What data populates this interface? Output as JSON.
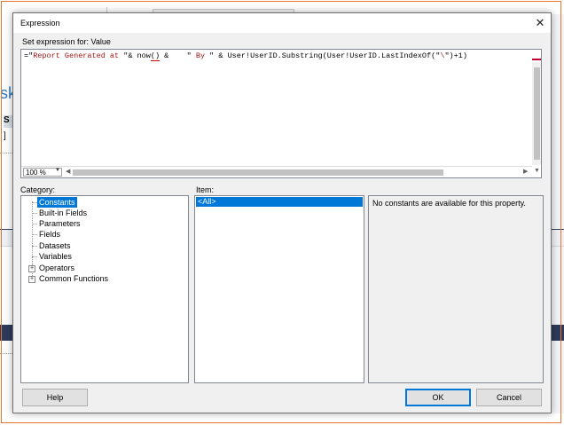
{
  "background": {
    "fragment_k": "sk",
    "fragment_s": "S",
    "fragment_bracket": "]"
  },
  "dialog": {
    "title": "Expression",
    "close_glyph": "✕",
    "set_expression_label": "Set expression for: Value",
    "expression": {
      "part1": "=\"",
      "str1": "Report Generated at ",
      "part2": "\"& now",
      "caret_text": "()",
      "part3": " &    \"",
      "str2": " By ",
      "part4": "\" & User!UserID.Substring(User!UserID.LastIndexOf(\"",
      "str3": "\\",
      "part5": "\")+1)"
    },
    "zoom": "100 %",
    "category_label": "Category:",
    "item_label": "Item:",
    "categories": [
      {
        "label": "Constants",
        "selected": true,
        "expandable": false
      },
      {
        "label": "Built-in Fields",
        "selected": false,
        "expandable": false
      },
      {
        "label": "Parameters",
        "selected": false,
        "expandable": false
      },
      {
        "label": "Fields",
        "selected": false,
        "expandable": false
      },
      {
        "label": "Datasets",
        "selected": false,
        "expandable": false
      },
      {
        "label": "Variables",
        "selected": false,
        "expandable": false
      },
      {
        "label": "Operators",
        "selected": false,
        "expandable": true
      },
      {
        "label": "Common Functions",
        "selected": false,
        "expandable": true
      }
    ],
    "items": [
      "<All>"
    ],
    "description": "No constants are available for this property.",
    "buttons": {
      "help": "Help",
      "ok": "OK",
      "cancel": "Cancel"
    }
  },
  "colors": {
    "selection": "#0078d7",
    "string_literal": "#a31515",
    "frame_outline": "#e8752f"
  }
}
